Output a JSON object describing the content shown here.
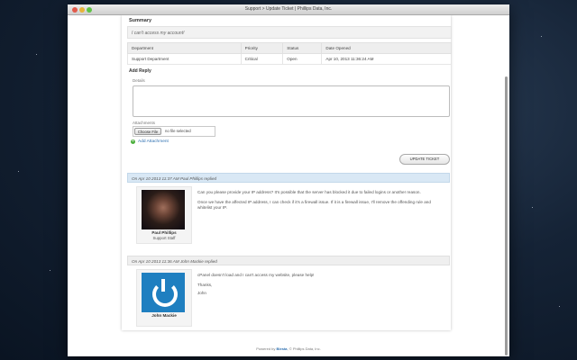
{
  "window": {
    "title": "Support > Update Ticket | Phillips Data, Inc."
  },
  "summary": {
    "heading": "Summary",
    "text": "I can't access my account!"
  },
  "ticket_table": {
    "headers": [
      "Department",
      "Priority",
      "Status",
      "Date Opened"
    ],
    "rows": [
      [
        "Support Department",
        "Critical",
        "Open",
        "Apr 10, 2013 11:36:24 AM"
      ]
    ]
  },
  "reply_form": {
    "heading": "Add Reply",
    "details_label": "Details",
    "attachments_label": "Attachments",
    "choose_file": "Choose File",
    "no_file": "no file selected",
    "add_attachment": "Add Attachment",
    "update_button": "UPDATE TICKET"
  },
  "replies": [
    {
      "header": "On Apr 10 2013 11:37 AM Paul Phillips replied",
      "author": "Paul Phillips",
      "role": "Support Staff",
      "paragraphs": [
        "Can you please provide your IP address? It's possible that the server has blocked it due to failed logins or another reason.",
        "Once we have the affected IP address, I can check if it's a firewall issue. If it is a firewall issue, I'll remove the offending rule and whitelist your IP."
      ]
    },
    {
      "header": "On Apr 10 2013 11:36 AM John Mackie replied",
      "author": "John Mackie",
      "role": "",
      "paragraphs": [
        "cPanel doesn't load and I can't access my website, please help!",
        "Thanks,",
        "John"
      ]
    }
  ],
  "footer": {
    "prefix": "Powered by",
    "brand": "Blesta",
    "suffix": ", © Phillips Data, Inc."
  },
  "colors": {
    "link": "#2d6fb0",
    "reply_head_staff": "#d9e8f5",
    "add_icon": "#4caf3d"
  }
}
